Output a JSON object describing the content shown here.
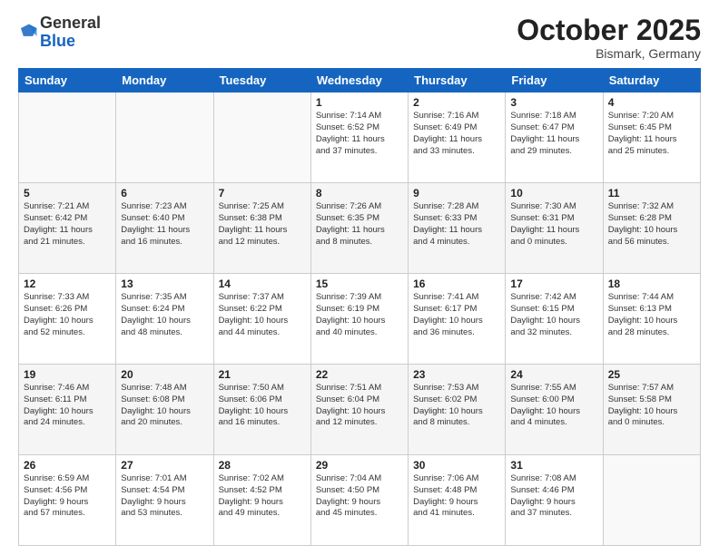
{
  "header": {
    "logo_general": "General",
    "logo_blue": "Blue",
    "month": "October 2025",
    "location": "Bismark, Germany"
  },
  "weekdays": [
    "Sunday",
    "Monday",
    "Tuesday",
    "Wednesday",
    "Thursday",
    "Friday",
    "Saturday"
  ],
  "weeks": [
    [
      {
        "day": "",
        "info": ""
      },
      {
        "day": "",
        "info": ""
      },
      {
        "day": "",
        "info": ""
      },
      {
        "day": "1",
        "info": "Sunrise: 7:14 AM\nSunset: 6:52 PM\nDaylight: 11 hours\nand 37 minutes."
      },
      {
        "day": "2",
        "info": "Sunrise: 7:16 AM\nSunset: 6:49 PM\nDaylight: 11 hours\nand 33 minutes."
      },
      {
        "day": "3",
        "info": "Sunrise: 7:18 AM\nSunset: 6:47 PM\nDaylight: 11 hours\nand 29 minutes."
      },
      {
        "day": "4",
        "info": "Sunrise: 7:20 AM\nSunset: 6:45 PM\nDaylight: 11 hours\nand 25 minutes."
      }
    ],
    [
      {
        "day": "5",
        "info": "Sunrise: 7:21 AM\nSunset: 6:42 PM\nDaylight: 11 hours\nand 21 minutes."
      },
      {
        "day": "6",
        "info": "Sunrise: 7:23 AM\nSunset: 6:40 PM\nDaylight: 11 hours\nand 16 minutes."
      },
      {
        "day": "7",
        "info": "Sunrise: 7:25 AM\nSunset: 6:38 PM\nDaylight: 11 hours\nand 12 minutes."
      },
      {
        "day": "8",
        "info": "Sunrise: 7:26 AM\nSunset: 6:35 PM\nDaylight: 11 hours\nand 8 minutes."
      },
      {
        "day": "9",
        "info": "Sunrise: 7:28 AM\nSunset: 6:33 PM\nDaylight: 11 hours\nand 4 minutes."
      },
      {
        "day": "10",
        "info": "Sunrise: 7:30 AM\nSunset: 6:31 PM\nDaylight: 11 hours\nand 0 minutes."
      },
      {
        "day": "11",
        "info": "Sunrise: 7:32 AM\nSunset: 6:28 PM\nDaylight: 10 hours\nand 56 minutes."
      }
    ],
    [
      {
        "day": "12",
        "info": "Sunrise: 7:33 AM\nSunset: 6:26 PM\nDaylight: 10 hours\nand 52 minutes."
      },
      {
        "day": "13",
        "info": "Sunrise: 7:35 AM\nSunset: 6:24 PM\nDaylight: 10 hours\nand 48 minutes."
      },
      {
        "day": "14",
        "info": "Sunrise: 7:37 AM\nSunset: 6:22 PM\nDaylight: 10 hours\nand 44 minutes."
      },
      {
        "day": "15",
        "info": "Sunrise: 7:39 AM\nSunset: 6:19 PM\nDaylight: 10 hours\nand 40 minutes."
      },
      {
        "day": "16",
        "info": "Sunrise: 7:41 AM\nSunset: 6:17 PM\nDaylight: 10 hours\nand 36 minutes."
      },
      {
        "day": "17",
        "info": "Sunrise: 7:42 AM\nSunset: 6:15 PM\nDaylight: 10 hours\nand 32 minutes."
      },
      {
        "day": "18",
        "info": "Sunrise: 7:44 AM\nSunset: 6:13 PM\nDaylight: 10 hours\nand 28 minutes."
      }
    ],
    [
      {
        "day": "19",
        "info": "Sunrise: 7:46 AM\nSunset: 6:11 PM\nDaylight: 10 hours\nand 24 minutes."
      },
      {
        "day": "20",
        "info": "Sunrise: 7:48 AM\nSunset: 6:08 PM\nDaylight: 10 hours\nand 20 minutes."
      },
      {
        "day": "21",
        "info": "Sunrise: 7:50 AM\nSunset: 6:06 PM\nDaylight: 10 hours\nand 16 minutes."
      },
      {
        "day": "22",
        "info": "Sunrise: 7:51 AM\nSunset: 6:04 PM\nDaylight: 10 hours\nand 12 minutes."
      },
      {
        "day": "23",
        "info": "Sunrise: 7:53 AM\nSunset: 6:02 PM\nDaylight: 10 hours\nand 8 minutes."
      },
      {
        "day": "24",
        "info": "Sunrise: 7:55 AM\nSunset: 6:00 PM\nDaylight: 10 hours\nand 4 minutes."
      },
      {
        "day": "25",
        "info": "Sunrise: 7:57 AM\nSunset: 5:58 PM\nDaylight: 10 hours\nand 0 minutes."
      }
    ],
    [
      {
        "day": "26",
        "info": "Sunrise: 6:59 AM\nSunset: 4:56 PM\nDaylight: 9 hours\nand 57 minutes."
      },
      {
        "day": "27",
        "info": "Sunrise: 7:01 AM\nSunset: 4:54 PM\nDaylight: 9 hours\nand 53 minutes."
      },
      {
        "day": "28",
        "info": "Sunrise: 7:02 AM\nSunset: 4:52 PM\nDaylight: 9 hours\nand 49 minutes."
      },
      {
        "day": "29",
        "info": "Sunrise: 7:04 AM\nSunset: 4:50 PM\nDaylight: 9 hours\nand 45 minutes."
      },
      {
        "day": "30",
        "info": "Sunrise: 7:06 AM\nSunset: 4:48 PM\nDaylight: 9 hours\nand 41 minutes."
      },
      {
        "day": "31",
        "info": "Sunrise: 7:08 AM\nSunset: 4:46 PM\nDaylight: 9 hours\nand 37 minutes."
      },
      {
        "day": "",
        "info": ""
      }
    ]
  ]
}
